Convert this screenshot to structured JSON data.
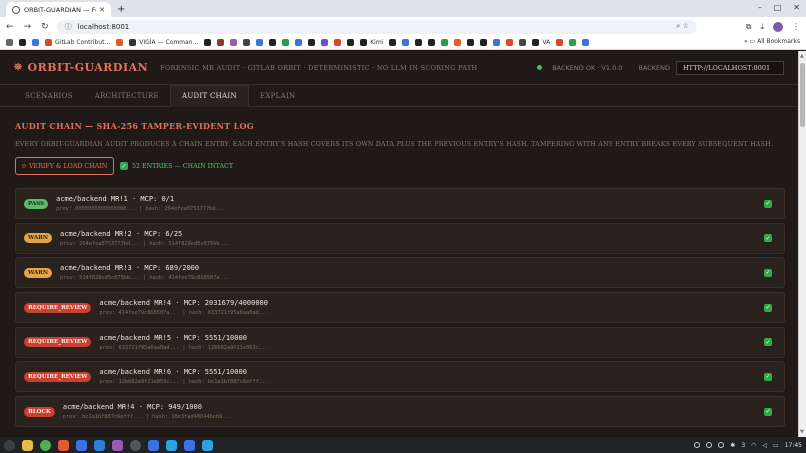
{
  "browser": {
    "tab_title": "ORBIT-GUARDIAN — Forensic",
    "url": "localhost:8001",
    "bookmarks": [
      {
        "label": "GitLab Contribut..."
      },
      {
        "label": ""
      },
      {
        "label": "VIGİA — Comman..."
      },
      {
        "label": "Kimi"
      },
      {
        "label": "VA"
      }
    ],
    "all_bookmarks": "All Bookmarks"
  },
  "app": {
    "brand": "ORBIT-GUARDIAN",
    "tagline": "FORENSIC MR AUDIT · GITLAB ORBIT · DETERMINISTIC · NO LLM IN SCORING PATH",
    "backend_status": "BACKEND OK · V1.0.0",
    "backend_label": "BACKEND",
    "backend_url": "HTTP://LOCALHOST:8001",
    "status_color": "#3fbf57"
  },
  "tabs": [
    {
      "label": "SCENARIOS",
      "active": false
    },
    {
      "label": "ARCHITECTURE",
      "active": false
    },
    {
      "label": "AUDIT CHAIN",
      "active": true
    },
    {
      "label": "EXPLAIN",
      "active": false
    }
  ],
  "audit": {
    "title": "AUDIT CHAIN — SHA-256 TAMPER-EVIDENT LOG",
    "desc_before": "EVERY ORBIT-GUARDIAN AUDIT PRODUCES A CHAIN ENTRY. EACH ENTRY'S HASH COVERS ITS OWN DATA ",
    "desc_em": "PLUS",
    "desc_after": " THE PREVIOUS ENTRY'S HASH. TAMPERING WITH ANY ENTRY BREAKS EVERY SUBSEQUENT HASH.",
    "verify_label": "⟳ VERIFY & LOAD CHAIN",
    "chain_status": "52 ENTRIES — CHAIN INTACT"
  },
  "entries": [
    {
      "badge": "PASS",
      "kind": "pass",
      "main": "acme/backend MR!1  ·  MCP: 0/1",
      "hash": "prev: 0000000000000000...  |  hash: 264efea0753777bd..."
    },
    {
      "badge": "WARN",
      "kind": "warn",
      "main": "acme/backend MR!2  ·  MCP: 6/25",
      "hash": "prev: 264efea0753777bd...  |  hash: 514f828ed5c075bb..."
    },
    {
      "badge": "WARN",
      "kind": "warn",
      "main": "acme/backend MR!3  ·  MCP: 689/2000",
      "hash": "prev: 514f828ed5c075bb...  |  hash: 414fee79c868507a..."
    },
    {
      "badge": "REQUIRE_REVIEW",
      "kind": "rr",
      "main": "acme/backend MR!4  ·  MCP: 2031679/4000000",
      "hash": "prev: 414fee79c868507a...  |  hash: 633721f95a6aa0ad..."
    },
    {
      "badge": "REQUIRE_REVIEW",
      "kind": "rr",
      "main": "acme/backend MR!5  ·  MCP: 5551/10000",
      "hash": "prev: 633721f95a6aa0ad...  |  hash: 12b682a9f21e053c..."
    },
    {
      "badge": "REQUIRE_REVIEW",
      "kind": "rr",
      "main": "acme/backend MR!6  ·  MCP: 5551/10000",
      "hash": "prev: 12b682a9f21e053c...  |  hash: bc1a1bf887c6efff..."
    },
    {
      "badge": "BLOCK",
      "kind": "block",
      "main": "acme/backend MR!4  ·  MCP: 949/1000",
      "hash": "prev: bc1a1bf887c6efff...  |  hash: 10e3fad40044beb9..."
    }
  ],
  "taskbar": {
    "time": "17:45",
    "badge": "3"
  }
}
